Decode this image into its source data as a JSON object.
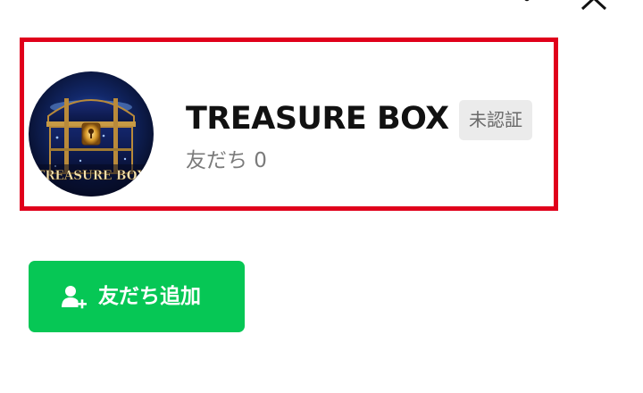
{
  "header": {
    "more_icon": "vertical-ellipsis-icon",
    "close_icon": "close-icon"
  },
  "profile": {
    "name": "TREASURE BOX",
    "verification_badge": "未認証",
    "friends": "友だち 0",
    "avatar_text": "TREASURE BOX",
    "highlight_color": "#e0001b"
  },
  "actions": {
    "add_friend_label": "友だち追加",
    "add_friend_icon": "person-plus-icon",
    "button_color": "#06c755"
  }
}
